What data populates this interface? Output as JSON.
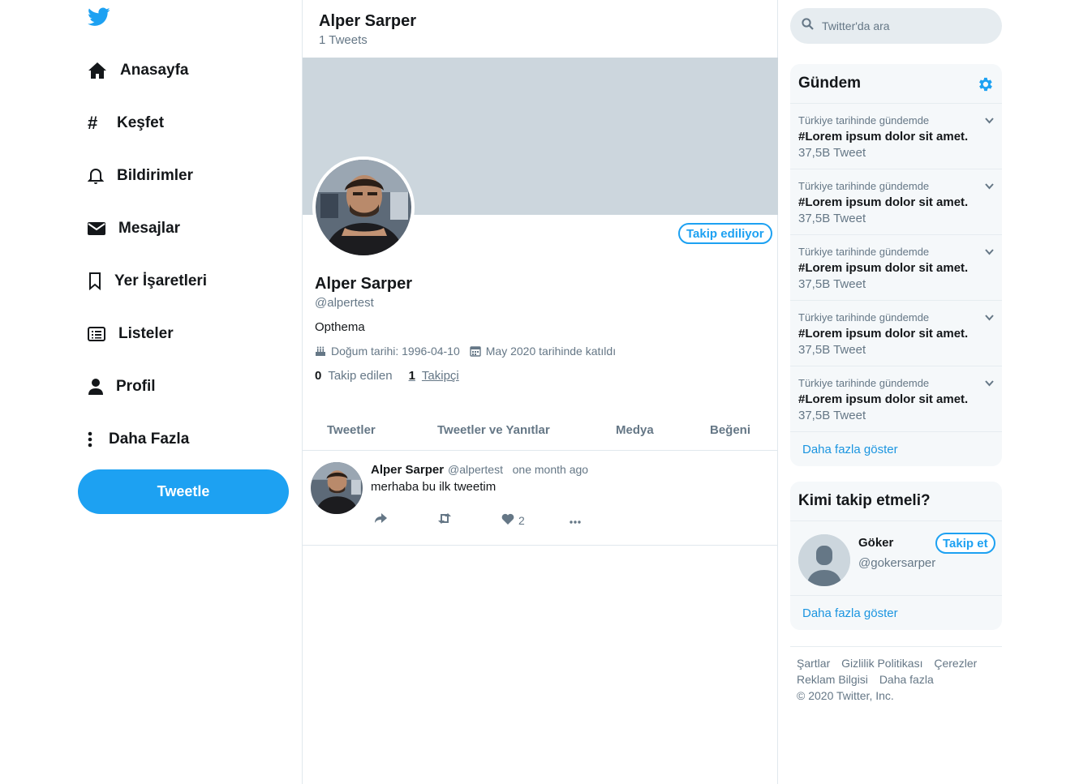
{
  "nav": {
    "items": [
      {
        "label": "Anasayfa",
        "icon": "home-icon"
      },
      {
        "label": "Keşfet",
        "icon": "hashtag-icon"
      },
      {
        "label": "Bildirimler",
        "icon": "bell-icon"
      },
      {
        "label": "Mesajlar",
        "icon": "envelope-icon"
      },
      {
        "label": "Yer İşaretleri",
        "icon": "bookmark-icon"
      },
      {
        "label": "Listeler",
        "icon": "list-icon"
      },
      {
        "label": "Profil",
        "icon": "user-icon"
      },
      {
        "label": "Daha Fazla",
        "icon": "more-vertical-icon"
      }
    ],
    "tweet_button": "Tweetle"
  },
  "header": {
    "name": "Alper Sarper",
    "tweet_count": "1 Tweets"
  },
  "profile": {
    "follow_status": "Takip ediliyor",
    "name": "Alper Sarper",
    "handle": "@alpertest",
    "bio": "Opthema",
    "birth": "Doğum tarihi: 1996-04-10",
    "joined": "May 2020 tarihinde katıldı",
    "following_count": "0",
    "following_label": "Takip edilen",
    "followers_count": "1",
    "followers_label": "Takipçi"
  },
  "tabs": [
    "Tweetler",
    "Tweetler ve Yanıtlar",
    "Medya",
    "Beğeni"
  ],
  "tweet": {
    "name": "Alper Sarper",
    "handle": "@alpertest",
    "time": "one month ago",
    "text": "merhaba bu ilk tweetim",
    "likes": "2"
  },
  "search": {
    "placeholder": "Twitter'da ara"
  },
  "trends": {
    "title": "Gündem",
    "items": [
      {
        "context": "Türkiye tarihinde gündemde",
        "topic": "#Lorem ipsum dolor sit amet.",
        "count": "37,5B Tweet"
      },
      {
        "context": "Türkiye tarihinde gündemde",
        "topic": "#Lorem ipsum dolor sit amet.",
        "count": "37,5B Tweet"
      },
      {
        "context": "Türkiye tarihinde gündemde",
        "topic": "#Lorem ipsum dolor sit amet.",
        "count": "37,5B Tweet"
      },
      {
        "context": "Türkiye tarihinde gündemde",
        "topic": "#Lorem ipsum dolor sit amet.",
        "count": "37,5B Tweet"
      },
      {
        "context": "Türkiye tarihinde gündemde",
        "topic": "#Lorem ipsum dolor sit amet.",
        "count": "37,5B Tweet"
      }
    ],
    "more": "Daha fazla göster"
  },
  "who_to_follow": {
    "title": "Kimi takip etmeli?",
    "user": {
      "name": "Göker",
      "handle": "@gokersarper",
      "button": "Takip et"
    },
    "more": "Daha fazla göster"
  },
  "footer": {
    "links": [
      "Şartlar",
      "Gizlilik Politikası",
      "Çerezler",
      "Reklam Bilgisi",
      "Daha fazla"
    ],
    "copyright": "© 2020 Twitter, Inc."
  },
  "colors": {
    "accent": "#1da1f2",
    "banner": "#ccd6dd",
    "panel": "#f5f8fa",
    "muted": "#657786"
  }
}
